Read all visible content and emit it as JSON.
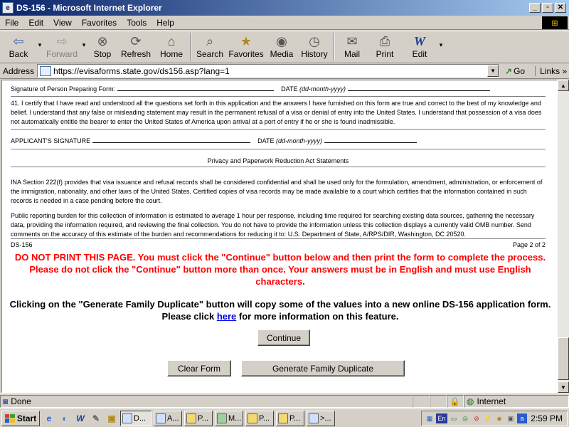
{
  "window": {
    "title": "DS-156 - Microsoft Internet Explorer",
    "app_icon": "ie-icon",
    "controls": {
      "minimize": "_",
      "maximize": "▫",
      "close": "✕"
    }
  },
  "menu": {
    "items": [
      "File",
      "Edit",
      "View",
      "Favorites",
      "Tools",
      "Help"
    ],
    "accelerators": [
      "F",
      "E",
      "V",
      "a",
      "T",
      "H"
    ]
  },
  "toolbar": {
    "back": "Back",
    "forward": "Forward",
    "stop": "Stop",
    "refresh": "Refresh",
    "home": "Home",
    "search": "Search",
    "favorites": "Favorites",
    "media": "Media",
    "history": "History",
    "mail": "Mail",
    "print": "Print",
    "edit": "Edit"
  },
  "address": {
    "label": "Address",
    "url": "https://evisaforms.state.gov/ds156.asp?lang=1",
    "go": "Go",
    "links": "Links"
  },
  "form": {
    "preparer_signature_label": "Signature of Person Preparing Form:",
    "date_label": "DATE",
    "date_format": "(dd-month-yyyy)",
    "certification": "41. I certify that I have read and understood all the questions set forth in this application and the answers I have furnished on this form are true and correct to the best of my knowledge and belief. I understand that any false or misleading statement may result in the permanent refusal of a visa or denial of entry into the United States. I understand that possession of a visa does not automatically entitle the bearer to enter the United States of America upon arrival at a port of entry if he or she is found inadmissible.",
    "applicant_signature_label": "APPLICANT'S SIGNATURE",
    "privacy_heading": "Privacy and Paperwork Reduction Act Statements",
    "ina_statement": "INA Section 222(f) provides that visa issuance and refusal records shall be considered confidential and shall be used only for the formulation, amendment, administration, or enforcement of the immigration, nationality, and other laws of the United States. Certified copies of visa records may be made available to a court which certifies that the information contained in such records is needed in a case pending before the court.",
    "burden_statement": "Public reporting burden for this collection of information is estimated to average 1 hour per response, including time required for searching existing data sources, gathering the necessary data, providing the information required, and reviewing the final collection. You do not have to provide the information unless this collection displays a currently valid OMB number. Send comments on the accuracy of this estimate of the burden and recommendations for reducing it to: U.S. Department of State, A/RPS/DIR, Washington, DC 20520.",
    "form_id": "DS-156",
    "page_indicator": "Page 2 of 2"
  },
  "notice": {
    "warning": "DO NOT PRINT THIS PAGE. You must click the \"Continue\" button below and then print the form to complete the process. Please do not click the \"Continue\" button more than once. Your answers must be in English and must use English characters.",
    "info_before_link": "Clicking on the \"Generate Family Duplicate\" button will copy some of the values into a new online DS-156 application form. Please click ",
    "info_link": "here",
    "info_after_link": " for more information on this feature."
  },
  "buttons": {
    "continue": "Continue",
    "clear_form": "Clear Form",
    "generate_duplicate": "Generate Family Duplicate"
  },
  "status": {
    "text": "Done",
    "zone": "Internet"
  },
  "taskbar": {
    "start": "Start",
    "items": [
      "D...",
      "A...",
      "P...",
      "M...",
      "P...",
      "P...",
      ">..."
    ],
    "tray_lang": "En",
    "clock": "2:59 PM"
  },
  "colors": {
    "warning_text": "#ff0000",
    "link": "#0000ee",
    "title_start": "#0a246a",
    "title_end": "#a6caf0"
  }
}
